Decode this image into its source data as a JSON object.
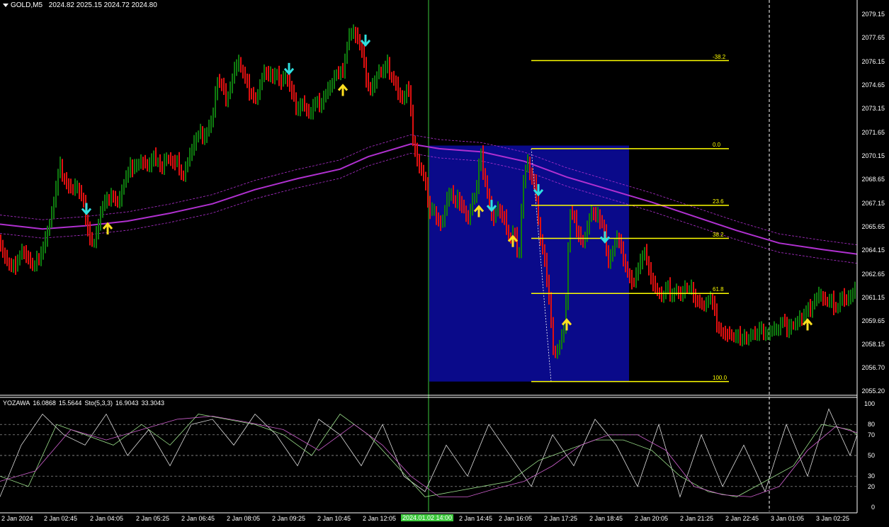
{
  "window": {
    "title": "GOLD,M5",
    "ohlc": [
      "2024.82",
      "2025.15",
      "2024.72",
      "2024.80"
    ]
  },
  "indicator": {
    "name": "YOZAWA",
    "values": [
      "16.0868",
      "15.5644"
    ],
    "stoch_name": "Sto(5,3,3)",
    "stoch_values": [
      "16.9043",
      "33.3043"
    ]
  },
  "price_axis": [
    "2079.15",
    "2077.65",
    "2076.15",
    "2074.65",
    "2073.15",
    "2071.65",
    "2070.15",
    "2068.65",
    "2067.15",
    "2065.65",
    "2064.15",
    "2062.65",
    "2061.15",
    "2059.65",
    "2058.15",
    "2056.70",
    "2055.20"
  ],
  "indicator_axis": [
    "100",
    "80",
    "70",
    "50",
    "30",
    "20",
    "0"
  ],
  "time_axis": [
    "2 Jan 2024",
    "2 Jan 02:45",
    "2 Jan 04:05",
    "2 Jan 05:25",
    "2 Jan 06:45",
    "2 Jan 08:05",
    "2 Jan 09:25",
    "2 Jan 10:45",
    "2 Jan 12:05",
    "2024.01.02 14:00",
    "2 Jan 14:45",
    "2 Jan 16:05",
    "2 Jan 17:25",
    "2 Jan 18:45",
    "2 Jan 20:05",
    "2 Jan 21:25",
    "2 Jan 22:45",
    "3 Jan 01:05",
    "3 Jan 02:25"
  ],
  "fibonacci": [
    "-38.2",
    "0.0",
    "23.6",
    "38.2",
    "61.8",
    "100.0"
  ],
  "colors": {
    "background": "#000000",
    "bull_bar": "#0f7a0f",
    "bear_bar": "#e01010",
    "ma": "#b030d0",
    "selection": "#0a0a8a",
    "fib": "#ffff00",
    "arrow_down": "#30e0e0",
    "arrow_up": "#ffe020"
  },
  "chart_data": {
    "type": "candlestick",
    "symbol": "GOLD",
    "timeframe": "M5",
    "y_range": [
      2055.2,
      2079.9
    ],
    "close_path": [
      [
        0,
        2064.6
      ],
      [
        6,
        2063.8
      ],
      [
        12,
        2063.0
      ],
      [
        18,
        2062.8
      ],
      [
        24,
        2063.6
      ],
      [
        30,
        2064.3
      ],
      [
        36,
        2063.9
      ],
      [
        42,
        2063.2
      ],
      [
        48,
        2062.9
      ],
      [
        54,
        2063.6
      ],
      [
        60,
        2064.4
      ],
      [
        66,
        2065.2
      ],
      [
        72,
        2066.2
      ],
      [
        78,
        2067.6
      ],
      [
        84,
        2069.3
      ],
      [
        90,
        2069.0
      ],
      [
        96,
        2068.4
      ],
      [
        102,
        2067.9
      ],
      [
        108,
        2068.2
      ],
      [
        114,
        2067.4
      ],
      [
        120,
        2066.6
      ],
      [
        126,
        2065.2
      ],
      [
        132,
        2064.5
      ],
      [
        138,
        2065.6
      ],
      [
        144,
        2066.7
      ],
      [
        150,
        2067.0
      ],
      [
        156,
        2068.0
      ],
      [
        162,
        2067.4
      ],
      [
        168,
        2067.2
      ],
      [
        174,
        2068.2
      ],
      [
        180,
        2068.8
      ],
      [
        186,
        2069.5
      ],
      [
        192,
        2069.7
      ],
      [
        198,
        2069.9
      ],
      [
        204,
        2069.6
      ],
      [
        210,
        2069.2
      ],
      [
        216,
        2069.9
      ],
      [
        222,
        2070.1
      ],
      [
        228,
        2069.4
      ],
      [
        234,
        2070.0
      ],
      [
        240,
        2069.8
      ],
      [
        246,
        2069.4
      ],
      [
        252,
        2069.6
      ],
      [
        258,
        2069.0
      ],
      [
        264,
        2069.7
      ],
      [
        270,
        2070.4
      ],
      [
        276,
        2071.0
      ],
      [
        282,
        2071.4
      ],
      [
        288,
        2071.6
      ],
      [
        294,
        2071.9
      ],
      [
        300,
        2072.6
      ],
      [
        306,
        2074.8
      ],
      [
        312,
        2074.4
      ],
      [
        318,
        2073.9
      ],
      [
        324,
        2074.4
      ],
      [
        330,
        2075.6
      ],
      [
        336,
        2076.1
      ],
      [
        342,
        2075.3
      ],
      [
        348,
        2074.6
      ],
      [
        354,
        2074.3
      ],
      [
        360,
        2073.8
      ],
      [
        366,
        2074.4
      ],
      [
        372,
        2075.4
      ],
      [
        378,
        2075.0
      ],
      [
        384,
        2075.2
      ],
      [
        390,
        2075.7
      ],
      [
        396,
        2074.8
      ],
      [
        402,
        2075.1
      ],
      [
        408,
        2074.6
      ],
      [
        414,
        2073.6
      ],
      [
        420,
        2073.2
      ],
      [
        426,
        2073.8
      ],
      [
        432,
        2073.0
      ],
      [
        438,
        2072.7
      ],
      [
        444,
        2073.2
      ],
      [
        450,
        2073.5
      ],
      [
        456,
        2073.9
      ],
      [
        462,
        2074.3
      ],
      [
        468,
        2074.7
      ],
      [
        474,
        2075.2
      ],
      [
        480,
        2075.0
      ],
      [
        486,
        2076.2
      ],
      [
        492,
        2077.9
      ],
      [
        498,
        2078.1
      ],
      [
        504,
        2077.5
      ],
      [
        510,
        2076.7
      ],
      [
        516,
        2075.4
      ],
      [
        522,
        2074.4
      ],
      [
        528,
        2074.8
      ],
      [
        534,
        2075.5
      ],
      [
        540,
        2075.2
      ],
      [
        546,
        2075.8
      ],
      [
        552,
        2075.4
      ],
      [
        558,
        2075.0
      ],
      [
        564,
        2073.8
      ],
      [
        570,
        2073.6
      ],
      [
        576,
        2074.6
      ],
      [
        582,
        2071.6
      ],
      [
        588,
        2070.2
      ],
      [
        594,
        2069.3
      ],
      [
        600,
        2068.6
      ],
      [
        606,
        2066.4
      ],
      [
        612,
        2066.4
      ],
      [
        618,
        2066.4
      ],
      [
        624,
        2065.8
      ],
      [
        630,
        2067.2
      ],
      [
        636,
        2067.9
      ],
      [
        642,
        2066.8
      ],
      [
        648,
        2067.4
      ],
      [
        654,
        2067.1
      ],
      [
        660,
        2066.0
      ],
      [
        666,
        2067.2
      ],
      [
        672,
        2067.4
      ],
      [
        678,
        2070.3
      ],
      [
        684,
        2068.9
      ],
      [
        690,
        2067.4
      ],
      [
        696,
        2066.0
      ],
      [
        702,
        2066.8
      ],
      [
        708,
        2066.1
      ],
      [
        714,
        2065.8
      ],
      [
        720,
        2065.0
      ],
      [
        726,
        2065.6
      ],
      [
        732,
        2063.1
      ],
      [
        738,
        2068.1
      ],
      [
        744,
        2069.6
      ],
      [
        750,
        2069.0
      ],
      [
        756,
        2068.4
      ],
      [
        762,
        2064.9
      ],
      [
        768,
        2063.8
      ],
      [
        774,
        2061.2
      ],
      [
        780,
        2058.2
      ],
      [
        786,
        2057.8
      ],
      [
        792,
        2058.5
      ],
      [
        798,
        2059.6
      ],
      [
        804,
        2066.4
      ],
      [
        810,
        2066.0
      ],
      [
        816,
        2065.5
      ],
      [
        822,
        2064.6
      ],
      [
        828,
        2065.4
      ],
      [
        834,
        2066.5
      ],
      [
        840,
        2066.0
      ],
      [
        846,
        2066.3
      ],
      [
        852,
        2065.9
      ],
      [
        858,
        2063.4
      ],
      [
        864,
        2063.8
      ],
      [
        870,
        2064.9
      ],
      [
        876,
        2064.2
      ],
      [
        882,
        2063.4
      ],
      [
        888,
        2062.7
      ],
      [
        894,
        2061.9
      ],
      [
        900,
        2062.8
      ],
      [
        906,
        2063.4
      ],
      [
        912,
        2064.0
      ],
      [
        918,
        2062.7
      ],
      [
        924,
        2061.8
      ],
      [
        930,
        2061.4
      ],
      [
        936,
        2061.0
      ],
      [
        942,
        2061.6
      ],
      [
        948,
        2061.5
      ],
      [
        954,
        2061.8
      ],
      [
        960,
        2061.2
      ],
      [
        966,
        2061.6
      ],
      [
        972,
        2061.4
      ],
      [
        978,
        2061.6
      ],
      [
        984,
        2061.0
      ],
      [
        990,
        2060.8
      ],
      [
        996,
        2060.6
      ],
      [
        1002,
        2061.0
      ],
      [
        1008,
        2060.2
      ],
      [
        1014,
        2059.4
      ],
      [
        1020,
        2059.0
      ],
      [
        1026,
        2058.8
      ],
      [
        1032,
        2058.6
      ],
      [
        1038,
        2058.4
      ],
      [
        1044,
        2058.6
      ],
      [
        1050,
        2058.8
      ],
      [
        1056,
        2058.6
      ],
      [
        1062,
        2058.8
      ],
      [
        1068,
        2058.6
      ],
      [
        1074,
        2058.9
      ],
      [
        1080,
        2059.1
      ],
      [
        1086,
        2059.0
      ],
      [
        1092,
        2059.1
      ],
      [
        1098,
        2059.0
      ],
      [
        1104,
        2059.4
      ],
      [
        1110,
        2059.2
      ],
      [
        1116,
        2059.6
      ],
      [
        1122,
        2059.4
      ],
      [
        1128,
        2059.8
      ],
      [
        1134,
        2059.6
      ],
      [
        1140,
        2060.2
      ],
      [
        1146,
        2060.8
      ],
      [
        1152,
        2061.2
      ],
      [
        1158,
        2061.4
      ],
      [
        1164,
        2060.8
      ],
      [
        1170,
        2060.6
      ],
      [
        1176,
        2060.8
      ],
      [
        1182,
        2060.6
      ],
      [
        1188,
        2061.4
      ],
      [
        1194,
        2060.8
      ],
      [
        1200,
        2061.0
      ],
      [
        1206,
        2061.4
      ]
    ],
    "ma_main": [
      [
        0,
        2065.8
      ],
      [
        60,
        2065.5
      ],
      [
        120,
        2065.7
      ],
      [
        180,
        2066.0
      ],
      [
        240,
        2066.5
      ],
      [
        300,
        2067.1
      ],
      [
        360,
        2068.0
      ],
      [
        420,
        2068.7
      ],
      [
        480,
        2069.3
      ],
      [
        520,
        2070.1
      ],
      [
        580,
        2070.9
      ],
      [
        620,
        2070.6
      ],
      [
        680,
        2070.4
      ],
      [
        740,
        2069.8
      ],
      [
        800,
        2068.8
      ],
      [
        860,
        2068.0
      ],
      [
        920,
        2067.2
      ],
      [
        980,
        2066.3
      ],
      [
        1040,
        2065.4
      ],
      [
        1100,
        2064.6
      ],
      [
        1160,
        2064.2
      ],
      [
        1210,
        2063.9
      ]
    ],
    "selection_box": {
      "price_top": 2070.8,
      "price_bottom": 2055.8,
      "bar_start": 606,
      "bar_end": 888
    },
    "fib_levels": [
      {
        "label": "-38.2",
        "price": 2076.2
      },
      {
        "label": "0.0",
        "price": 2070.6
      },
      {
        "label": "23.6",
        "price": 2067.0
      },
      {
        "label": "38.2",
        "price": 2064.9
      },
      {
        "label": "61.8",
        "price": 2061.4
      },
      {
        "label": "100.0",
        "price": 2055.8
      }
    ],
    "signals_down": [
      [
        122,
        2066.7
      ],
      [
        408,
        2075.6
      ],
      [
        516,
        2077.4
      ],
      [
        694,
        2066.9
      ],
      [
        760,
        2067.9
      ],
      [
        854,
        2064.9
      ]
    ],
    "signals_up": [
      [
        152,
        2065.6
      ],
      [
        484,
        2074.4
      ],
      [
        676,
        2066.7
      ],
      [
        724,
        2064.8
      ],
      [
        800,
        2059.5
      ],
      [
        1140,
        2059.5
      ]
    ],
    "stoch_main": [
      [
        0,
        10
      ],
      [
        30,
        60
      ],
      [
        60,
        90
      ],
      [
        90,
        70
      ],
      [
        120,
        60
      ],
      [
        150,
        90
      ],
      [
        180,
        50
      ],
      [
        210,
        75
      ],
      [
        240,
        40
      ],
      [
        270,
        80
      ],
      [
        300,
        85
      ],
      [
        330,
        60
      ],
      [
        360,
        90
      ],
      [
        390,
        70
      ],
      [
        420,
        40
      ],
      [
        450,
        85
      ],
      [
        480,
        70
      ],
      [
        510,
        40
      ],
      [
        540,
        80
      ],
      [
        570,
        30
      ],
      [
        600,
        15
      ],
      [
        630,
        60
      ],
      [
        660,
        30
      ],
      [
        690,
        80
      ],
      [
        720,
        50
      ],
      [
        750,
        20
      ],
      [
        780,
        70
      ],
      [
        810,
        40
      ],
      [
        840,
        85
      ],
      [
        870,
        60
      ],
      [
        900,
        20
      ],
      [
        930,
        80
      ],
      [
        960,
        10
      ],
      [
        990,
        70
      ],
      [
        1020,
        20
      ],
      [
        1050,
        60
      ],
      [
        1080,
        15
      ],
      [
        1110,
        80
      ],
      [
        1140,
        30
      ],
      [
        1170,
        95
      ],
      [
        1200,
        50
      ],
      [
        1210,
        70
      ]
    ],
    "stoch_signal": [
      [
        0,
        30
      ],
      [
        40,
        20
      ],
      [
        80,
        80
      ],
      [
        120,
        70
      ],
      [
        160,
        60
      ],
      [
        200,
        80
      ],
      [
        240,
        60
      ],
      [
        280,
        90
      ],
      [
        320,
        85
      ],
      [
        360,
        80
      ],
      [
        400,
        70
      ],
      [
        440,
        50
      ],
      [
        480,
        90
      ],
      [
        520,
        70
      ],
      [
        560,
        40
      ],
      [
        600,
        10
      ],
      [
        640,
        15
      ],
      [
        680,
        20
      ],
      [
        720,
        25
      ],
      [
        760,
        45
      ],
      [
        800,
        55
      ],
      [
        840,
        65
      ],
      [
        880,
        65
      ],
      [
        920,
        55
      ],
      [
        960,
        30
      ],
      [
        1000,
        15
      ],
      [
        1040,
        10
      ],
      [
        1080,
        25
      ],
      [
        1120,
        40
      ],
      [
        1160,
        80
      ],
      [
        1200,
        75
      ],
      [
        1210,
        70
      ]
    ],
    "stoch_d": [
      [
        0,
        25
      ],
      [
        50,
        35
      ],
      [
        100,
        75
      ],
      [
        150,
        65
      ],
      [
        200,
        75
      ],
      [
        250,
        85
      ],
      [
        300,
        88
      ],
      [
        350,
        82
      ],
      [
        400,
        75
      ],
      [
        450,
        55
      ],
      [
        500,
        80
      ],
      [
        540,
        60
      ],
      [
        580,
        30
      ],
      [
        620,
        10
      ],
      [
        660,
        10
      ],
      [
        700,
        18
      ],
      [
        740,
        25
      ],
      [
        780,
        40
      ],
      [
        820,
        60
      ],
      [
        860,
        70
      ],
      [
        900,
        70
      ],
      [
        940,
        55
      ],
      [
        980,
        20
      ],
      [
        1020,
        12
      ],
      [
        1060,
        10
      ],
      [
        1100,
        20
      ],
      [
        1140,
        55
      ],
      [
        1180,
        78
      ],
      [
        1210,
        72
      ]
    ]
  }
}
